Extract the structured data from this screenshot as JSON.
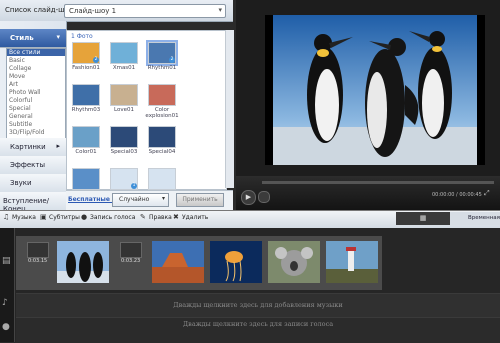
{
  "header": {
    "style_list_label": "Список слайд-шоу:",
    "style_select_value": "Слайд-шоу 1"
  },
  "left_nav": {
    "style_label": "Стиль",
    "style_items": [
      "Все стили",
      "Basic",
      "Collage",
      "Move",
      "Art",
      "Photo Wall",
      "Colorful",
      "Special",
      "General",
      "Subtitle",
      "3D/Flip/Fold"
    ],
    "selected_style": "Все стили",
    "pictures_label": "Картинки",
    "effects_label": "Эффекты",
    "sounds_label": "Звуки",
    "intro_label": "Вступление/Конец"
  },
  "gallery": {
    "page_label": "1 Фото",
    "items": [
      {
        "caption": "Fashion01",
        "badge": "2"
      },
      {
        "caption": "Xmas01",
        "badge": ""
      },
      {
        "caption": "Rhythm01",
        "badge": "2"
      },
      {
        "caption": "Rhythm03",
        "badge": ""
      },
      {
        "caption": "Love01",
        "badge": ""
      },
      {
        "caption": "Color explosion01",
        "badge": ""
      },
      {
        "caption": "Color01",
        "badge": ""
      },
      {
        "caption": "Special03",
        "badge": ""
      },
      {
        "caption": "Special04",
        "badge": ""
      },
      {
        "caption": "",
        "badge": ""
      },
      {
        "caption": "",
        "badge": "1"
      },
      {
        "caption": "",
        "badge": ""
      }
    ],
    "free_link": "Бесплатные ресурсы",
    "random_select": "Случайно",
    "apply_button": "Применить"
  },
  "player": {
    "time": "00:00:00 / 00:00:45"
  },
  "timeline_toolbar": {
    "music": "Музыка",
    "subtitles": "Субтитры",
    "voice": "Запись голоса",
    "edit": "Правка",
    "delete": "Удалить",
    "timeline_view": "Временная шкала"
  },
  "timeline": {
    "clips": [
      {
        "time": "0:03.15"
      },
      {
        "time": "0:03.23"
      },
      {
        "time": ""
      },
      {
        "time": ""
      },
      {
        "time": ""
      },
      {
        "time": ""
      }
    ],
    "music_hint": "Дважды щелкните здесь для добавления музыки",
    "voice_hint": "Дважды щелкните здесь для записи голоса"
  }
}
